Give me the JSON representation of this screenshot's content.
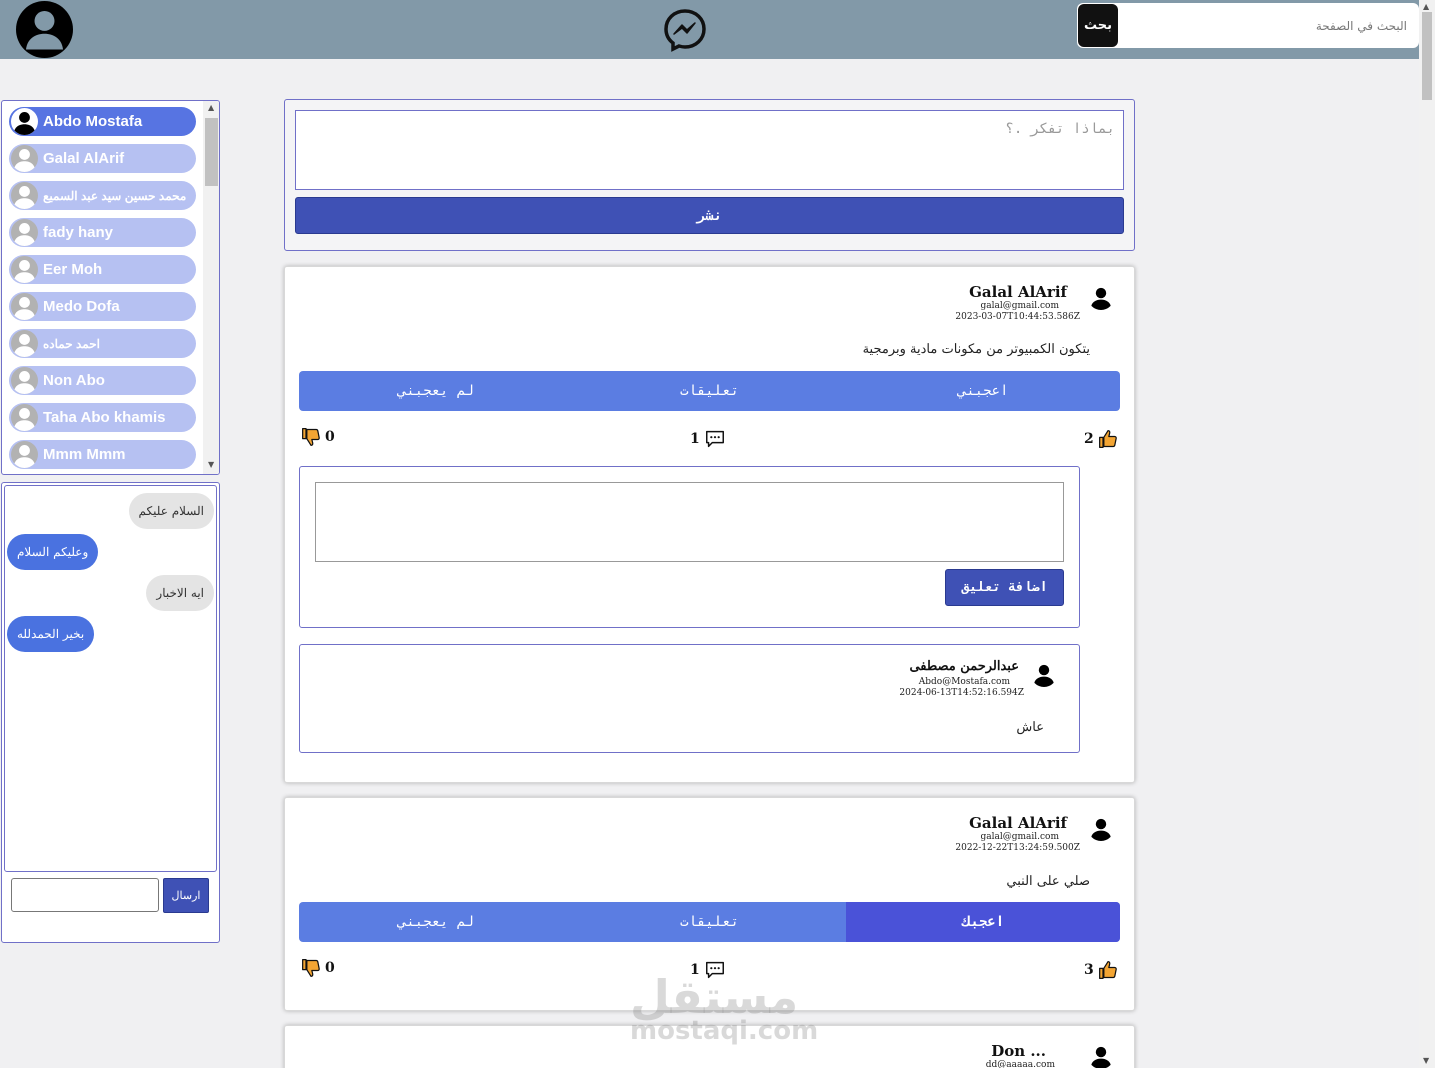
{
  "header": {
    "search_placeholder": "البحث في الصفحة",
    "search_button": "بحث",
    "messenger_icon": "messenger-icon",
    "avatar_icon": "user-avatar-icon"
  },
  "composer": {
    "placeholder": "بماذا تفكر .؟",
    "publish_label": "نشر"
  },
  "friends": {
    "items": [
      {
        "name": "Abdo Mostafa",
        "active": true
      },
      {
        "name": "Galal AlArif"
      },
      {
        "name": "محمد حسين سيد عبد السميع"
      },
      {
        "name": "fady hany"
      },
      {
        "name": "Eer Moh"
      },
      {
        "name": "Medo Dofa"
      },
      {
        "name": "احمد حماده"
      },
      {
        "name": "Non Abo"
      },
      {
        "name": "Taha Abo khamis"
      },
      {
        "name": "Mmm Mmm"
      }
    ]
  },
  "chat": {
    "messages": [
      {
        "text": "السلام عليكم",
        "side": "in"
      },
      {
        "text": "وعليكم السلام",
        "side": "out"
      },
      {
        "text": "ايه الاخبار",
        "side": "in"
      },
      {
        "text": "بخير الحمدلله",
        "side": "out"
      }
    ],
    "send_label": "ارسال"
  },
  "posts": [
    {
      "author": "Galal AlArif",
      "email": "galal@gmail.com",
      "date": "2023-03-07T10:44:53.586Z",
      "text": "يتكون الكمبيوتر من مكونات مادية وبرمجية",
      "actions": {
        "like": "اعجبني",
        "comments": "تعليقات",
        "dislike": "لم يعجبني"
      },
      "liked": false,
      "likes": "2",
      "comments_count": "1",
      "dislikes": "0",
      "add_comment_label": "اضافة تعليق",
      "comment": {
        "author": "عبدالرحمن مصطفى",
        "email": "Abdo@Mostafa.com",
        "date": "2024-06-13T14:52:16.594Z",
        "text": "عاش"
      }
    },
    {
      "author": "Galal AlArif",
      "email": "galal@gmail.com",
      "date": "2022-12-22T13:24:59.500Z",
      "text": "صلي على النبي",
      "actions": {
        "like": "اعجبك",
        "comments": "تعليقات",
        "dislike": "لم يعجبني"
      },
      "liked": true,
      "likes": "3",
      "comments_count": "1",
      "dislikes": "0"
    },
    {
      "author": "Don ...",
      "email": "dd@aaaaa.com"
    }
  ],
  "watermark": {
    "main": "مستقل",
    "sub": "mostaqi.com"
  },
  "colors": {
    "topbar": "#8299a8",
    "primary": "#3f51b5",
    "action_bar": "#5b7de2",
    "liked": "#4a52d8",
    "friend_pill": "#b6c1f2",
    "friend_active": "#5774e2"
  }
}
